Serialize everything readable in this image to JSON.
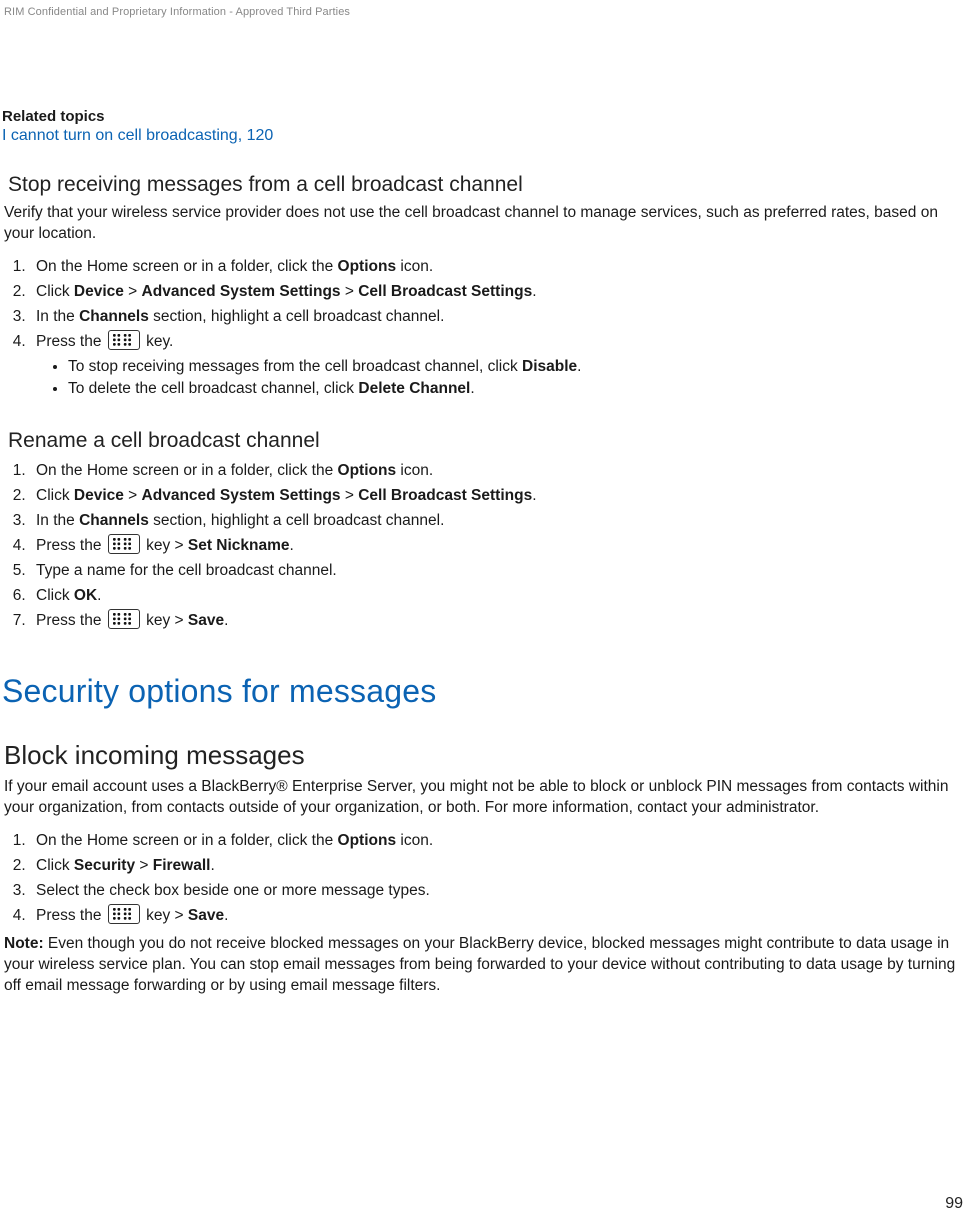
{
  "header": {
    "confidential": "RIM Confidential and Proprietary Information - Approved Third Parties"
  },
  "related": {
    "heading": "Related topics",
    "link_text": "I cannot turn on cell broadcasting, 120"
  },
  "stop_section": {
    "title": "Stop receiving messages from a cell broadcast channel",
    "intro": "Verify that your wireless service provider does not use the cell broadcast channel to manage services, such as preferred rates, based on your location.",
    "s1_a": "On the Home screen or in a folder, click the ",
    "s1_b": "Options",
    "s1_c": " icon.",
    "s2_a": "Click ",
    "s2_b": "Device",
    "s2_c": " > ",
    "s2_d": "Advanced System Settings",
    "s2_e": " > ",
    "s2_f": "Cell Broadcast Settings",
    "s2_g": ".",
    "s3_a": "In the ",
    "s3_b": "Channels",
    "s3_c": " section, highlight a cell broadcast channel.",
    "s4_a": "Press the ",
    "s4_b": " key.",
    "b1_a": "To stop receiving messages from the cell broadcast channel, click ",
    "b1_b": "Disable",
    "b1_c": ".",
    "b2_a": "To delete the cell broadcast channel, click ",
    "b2_b": "Delete Channel",
    "b2_c": "."
  },
  "rename_section": {
    "title": "Rename a cell broadcast channel",
    "s1_a": "On the Home screen or in a folder, click the ",
    "s1_b": "Options",
    "s1_c": " icon.",
    "s2_a": "Click ",
    "s2_b": "Device",
    "s2_c": " > ",
    "s2_d": "Advanced System Settings",
    "s2_e": " > ",
    "s2_f": "Cell Broadcast Settings",
    "s2_g": ".",
    "s3_a": "In the ",
    "s3_b": "Channels",
    "s3_c": " section, highlight a cell broadcast channel.",
    "s4_a": "Press the ",
    "s4_b": " key > ",
    "s4_c": "Set Nickname",
    "s4_d": ".",
    "s5": "Type a name for the cell broadcast channel.",
    "s6_a": "Click ",
    "s6_b": "OK",
    "s6_c": ".",
    "s7_a": "Press the ",
    "s7_b": " key > ",
    "s7_c": "Save",
    "s7_d": "."
  },
  "security": {
    "h1": "Security options for messages",
    "h2": "Block incoming messages",
    "intro": "If your email account uses a BlackBerry® Enterprise Server, you might not be able to block or unblock PIN messages from contacts within your organization, from contacts outside of your organization, or both. For more information, contact your administrator.",
    "s1_a": "On the Home screen or in a folder, click the ",
    "s1_b": "Options",
    "s1_c": " icon.",
    "s2_a": "Click ",
    "s2_b": "Security",
    "s2_c": " > ",
    "s2_d": "Firewall",
    "s2_e": ".",
    "s3": "Select the check box beside one or more message types.",
    "s4_a": "Press the ",
    "s4_b": " key > ",
    "s4_c": "Save",
    "s4_d": ".",
    "note_label": "Note:",
    "note_body": " Even though you do not receive blocked messages on your BlackBerry device, blocked messages might contribute to data usage in your wireless service plan. You can stop email messages from being forwarded to your device without contributing to data usage by turning off email message forwarding or by using email message filters."
  },
  "page_number": "99"
}
